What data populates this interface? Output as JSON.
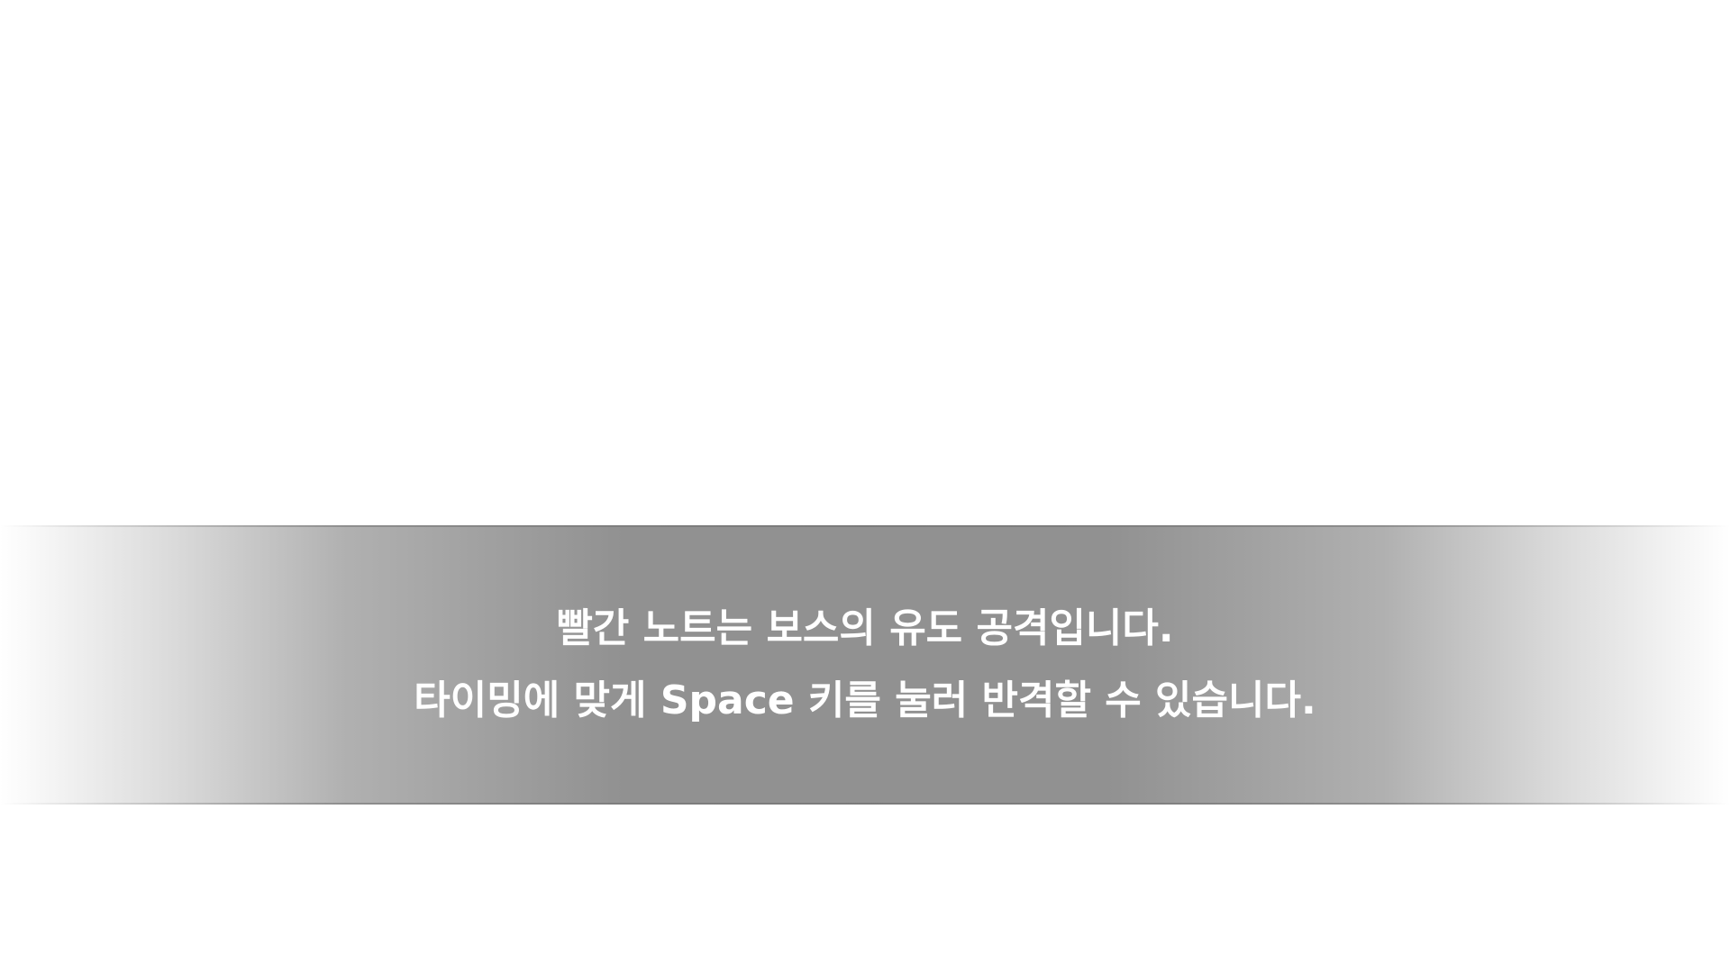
{
  "tutorial": {
    "line1": "빨간 노트는 보스의 유도 공격입니다.",
    "line2": "타이밍에 맞게 Space 키를 눌러 반격할 수 있습니다."
  },
  "colors": {
    "background": "#ffffff",
    "banner": "#919191",
    "text": "#ffffff"
  }
}
